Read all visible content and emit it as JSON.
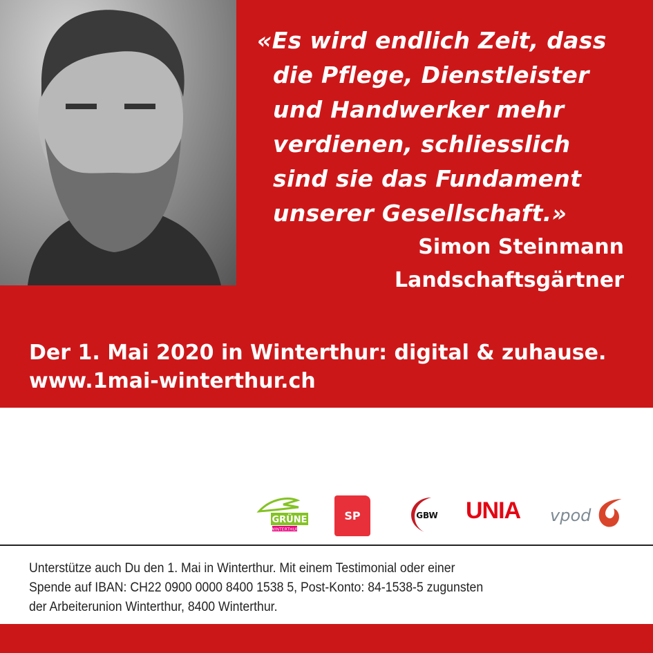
{
  "quote": {
    "lines": [
      "«Es wird endlich Zeit, dass",
      "die Pflege, Dienstleister",
      "und Handwerker mehr",
      "verdienen, schliesslich",
      "sind sie das Fundament",
      "unserer Gesellschaft.»"
    ]
  },
  "person": {
    "name": "Simon Steinmann",
    "job": "Landschaftsgärtner"
  },
  "event": {
    "line1": "Der 1. Mai 2020 in Winterthur: digital & zuhause.",
    "url": "www.1mai-winterthur.ch"
  },
  "logos": {
    "gruene": "GRÜNE",
    "gruene_sub": "WINTERTHUR",
    "sp": "SP",
    "gbw": "GBW",
    "unia": "UNIA",
    "vpod": "vpod"
  },
  "info": {
    "lines": [
      "Unterstütze auch Du den 1. Mai in Winterthur. Mit einem Testimonial oder einer",
      "Spende auf IBAN: CH22 0900 0000 8400 1538 5, Post-Konto: 84-1538-5 zugunsten",
      "der Arbeiterunion Winterthur, 8400 Winterthur."
    ]
  },
  "colors": {
    "brand_red": "#cc1719",
    "gruene_green": "#84c225",
    "sp_red": "#e8303a"
  }
}
